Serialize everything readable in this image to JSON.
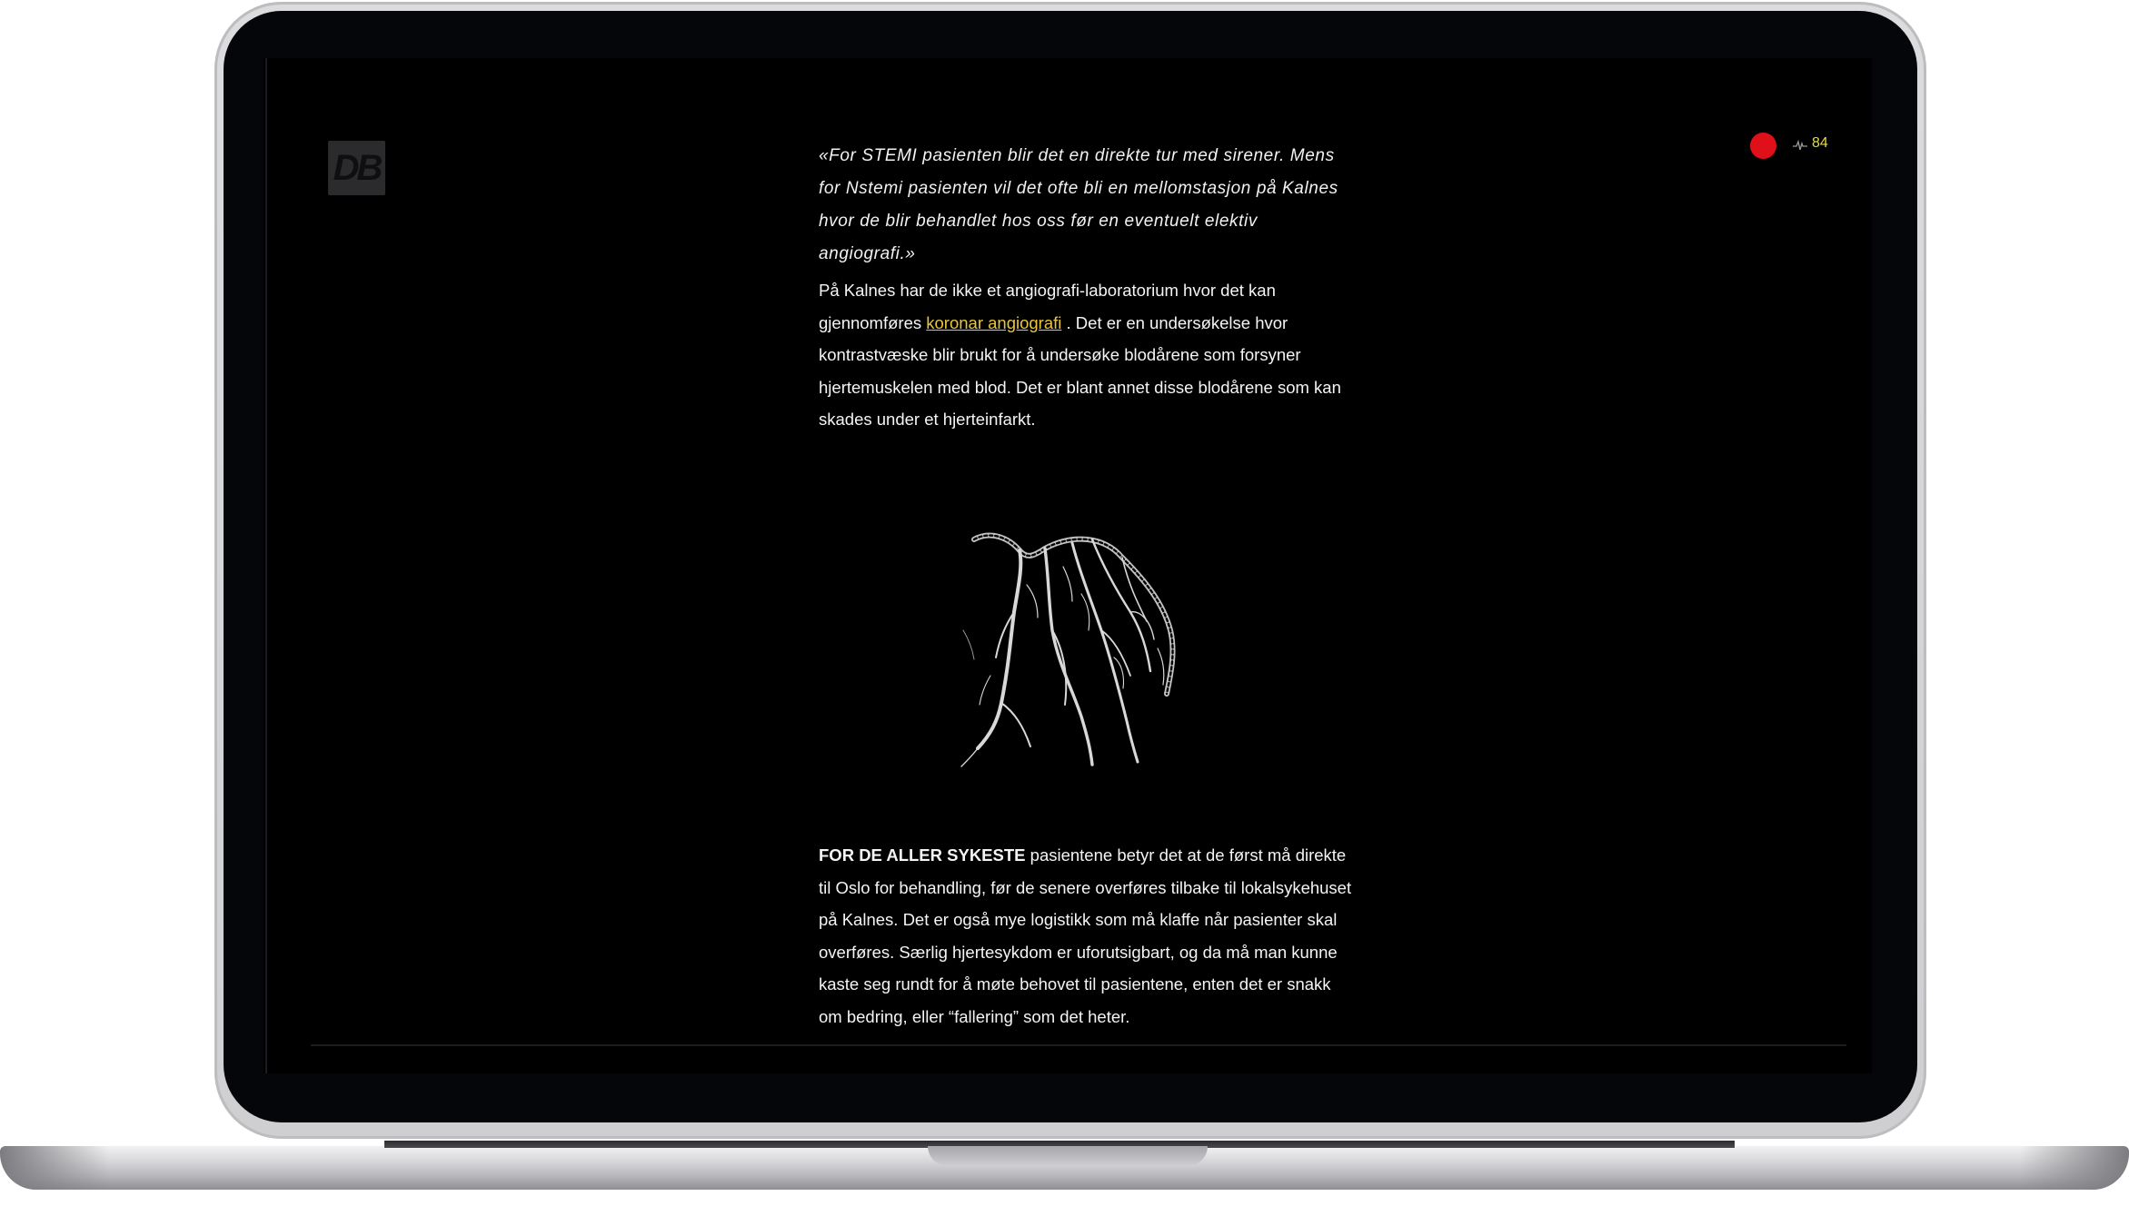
{
  "header": {
    "logo_text": "DB",
    "recording_color": "#e0101a",
    "pulse_icon": "heartbeat-icon",
    "pulse_value": "84",
    "pulse_color": "#e6d94a"
  },
  "article": {
    "quote": "«For STEMI pasienten blir det en direkte tur med sirener. Mens for Nstemi pasienten vil det ofte bli en mellomstasjon på Kalnes hvor de blir behandlet hos oss før en eventuelt elektiv angiografi.»",
    "para1_before": "På Kalnes har de ikke et angiografi-laboratorium hvor det kan gjennomføres ",
    "para1_link": "koronar angiografi",
    "para1_after": " . Det er en undersøkelse hvor kontrastvæske blir brukt for å undersøke blodårene som forsyner hjertemuskelen med blod. Det er blant annet disse blodårene som kan skades under et hjerteinfarkt.",
    "image_icon": "coronary-artery-illustration",
    "para2_lead": "FOR DE ALLER SYKESTE",
    "para2_rest": " pasientene betyr det at de først må direkte til Oslo for behandling, før de senere overføres tilbake til lokalsykehuset på Kalnes. Det er også mye logistikk som må klaffe når pasienter skal overføres. Særlig hjertesykdom er uforutsigbart, og da må man kunne kaste seg rundt for å møte behovet til pasientene, enten det er snakk om bedring, eller “fallering” som det heter."
  },
  "colors": {
    "link": "#e8c53a",
    "background": "#000000",
    "text": "#f4f4f4"
  }
}
